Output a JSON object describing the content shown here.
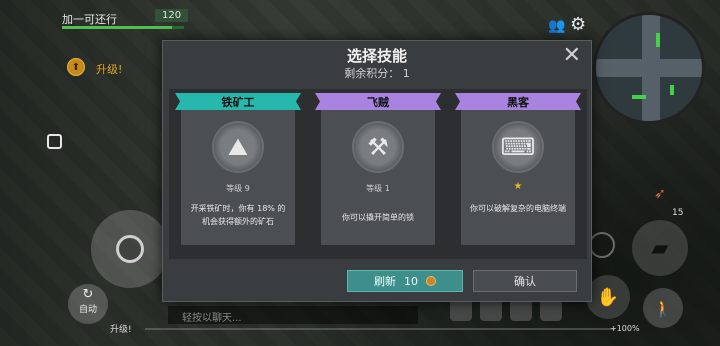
{
  "hud": {
    "player_name": "加一可还行",
    "hp_value": "120",
    "hp_fraction": 0.9,
    "levelup_label": "升级!",
    "auto_icon": "↻",
    "auto_label": "自动",
    "bottom_levelup": "升级!",
    "xp_percent_label": "+100%",
    "chat_placeholder": "轻按以聊天...",
    "ammo_count": "15",
    "icons": {
      "friends": "people-icon",
      "settings": "gear-icon",
      "gun": "pistol-icon",
      "hand": "hand-icon",
      "sneak": "sneak-icon",
      "ammo": "bullets-icon"
    }
  },
  "modal": {
    "title": "选择技能",
    "subtitle": "剩余积分： 1",
    "close_symbol": "✕",
    "cards": [
      {
        "name": "铁矿工",
        "level": "等级 9",
        "description": "开采铁矿时，你有 18% 的机会获得额外的矿石",
        "banner_color": "#27b8ad",
        "icon": "ore-icon",
        "icon_glyph": "⛰"
      },
      {
        "name": "飞贼",
        "level": "等级 1",
        "description": "你可以撬开简单的锁",
        "banner_color": "#a884e0",
        "icon": "lockpick-icon",
        "icon_glyph": "⚒"
      },
      {
        "name": "黑客",
        "star": "★",
        "description": "你可以破解复杂的电脑终端",
        "banner_color": "#a884e0",
        "icon": "terminal-icon",
        "icon_glyph": "⌨"
      }
    ],
    "refresh_label": "刷新",
    "refresh_cost": "10",
    "confirm_label": "确认",
    "accent_color": "#3e8f8c"
  }
}
